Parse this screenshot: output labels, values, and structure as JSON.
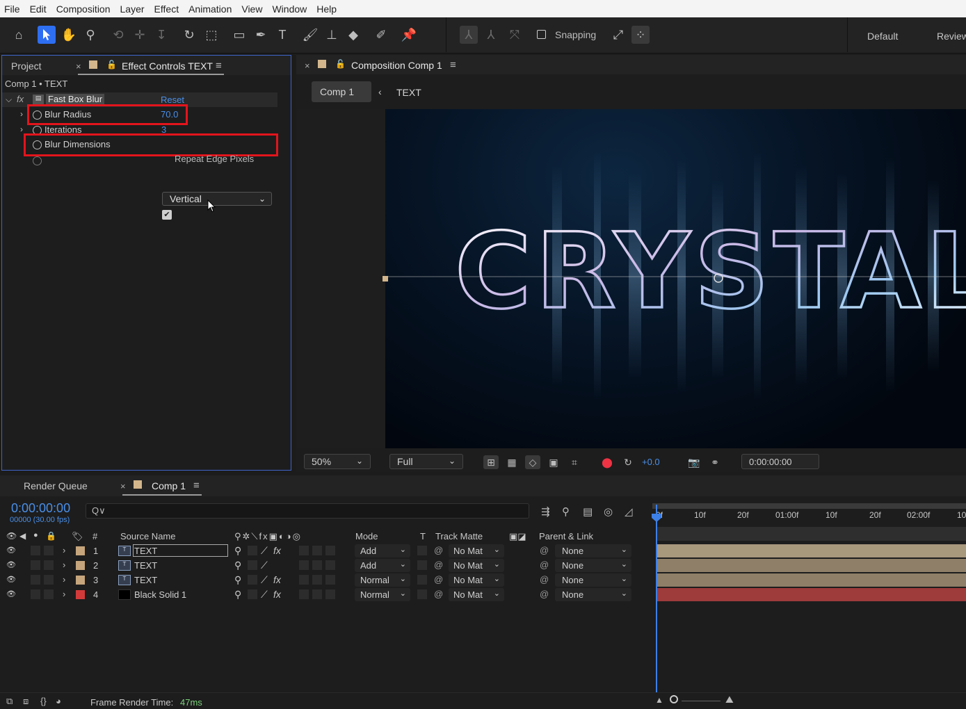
{
  "menu": [
    "File",
    "Edit",
    "Composition",
    "Layer",
    "Effect",
    "Animation",
    "View",
    "Window",
    "Help"
  ],
  "toolbar": {
    "snapping_label": "Snapping",
    "workspace_default": "Default",
    "workspace_review": "Review"
  },
  "effect_controls": {
    "tab_project": "Project",
    "tab_effect_controls": "Effect Controls TEXT",
    "breadcrumb": "Comp 1 • TEXT",
    "effect_name": "Fast Box Blur",
    "reset_label": "Reset",
    "params": [
      {
        "label": "Blur Radius",
        "value": "70.0"
      },
      {
        "label": "Iterations",
        "value": "3"
      },
      {
        "label": "Blur Dimensions",
        "value": "Vertical"
      },
      {
        "label": "Repeat Edge Pixels",
        "checked": true
      }
    ]
  },
  "composition": {
    "tab_label": "Composition Comp 1",
    "crumb_comp": "Comp 1",
    "crumb_layer": "TEXT",
    "canvas_text": "CRYSTAL",
    "zoom": "50%",
    "resolution": "Full",
    "exposure": "+0.0",
    "timecode": "0:00:00:00"
  },
  "timeline": {
    "tab_render_queue": "Render Queue",
    "tab_comp": "Comp 1",
    "current_time": "0:00:00:00",
    "frame_info": "00000 (30.00 fps)",
    "search_placeholder": "Q∨",
    "columns": {
      "num": "#",
      "source_name": "Source Name",
      "mode": "Mode",
      "t": "T",
      "track_matte": "Track Matte",
      "parent": "Parent & Link"
    },
    "ruler_ticks": [
      "0f",
      "10f",
      "20f",
      "01:00f",
      "10f",
      "20f",
      "02:00f",
      "10"
    ],
    "layers": [
      {
        "num": "1",
        "name": "TEXT",
        "mode": "Add",
        "matte": "No Mat",
        "parent": "None",
        "label_color": "#c6a57c",
        "bar_color": "#a8987c",
        "type": "text",
        "fx": true
      },
      {
        "num": "2",
        "name": "TEXT",
        "mode": "Add",
        "matte": "No Mat",
        "parent": "None",
        "label_color": "#c6a57c",
        "bar_color": "#8f7f68",
        "type": "text",
        "fx": false
      },
      {
        "num": "3",
        "name": "TEXT",
        "mode": "Normal",
        "matte": "No Mat",
        "parent": "None",
        "label_color": "#c6a57c",
        "bar_color": "#8f7f68",
        "type": "text",
        "fx": true
      },
      {
        "num": "4",
        "name": "Black Solid 1",
        "mode": "Normal",
        "matte": "No Mat",
        "parent": "None",
        "label_color": "#d23a3a",
        "bar_color": "#9e3b3b",
        "type": "solid",
        "fx": true
      }
    ],
    "frame_render_label": "Frame Render Time:",
    "frame_render_value": "47ms"
  },
  "colors": {
    "accent_blue": "#4a8fe8",
    "highlight_red": "#e3141c",
    "panel_border": "#3f64c9"
  }
}
